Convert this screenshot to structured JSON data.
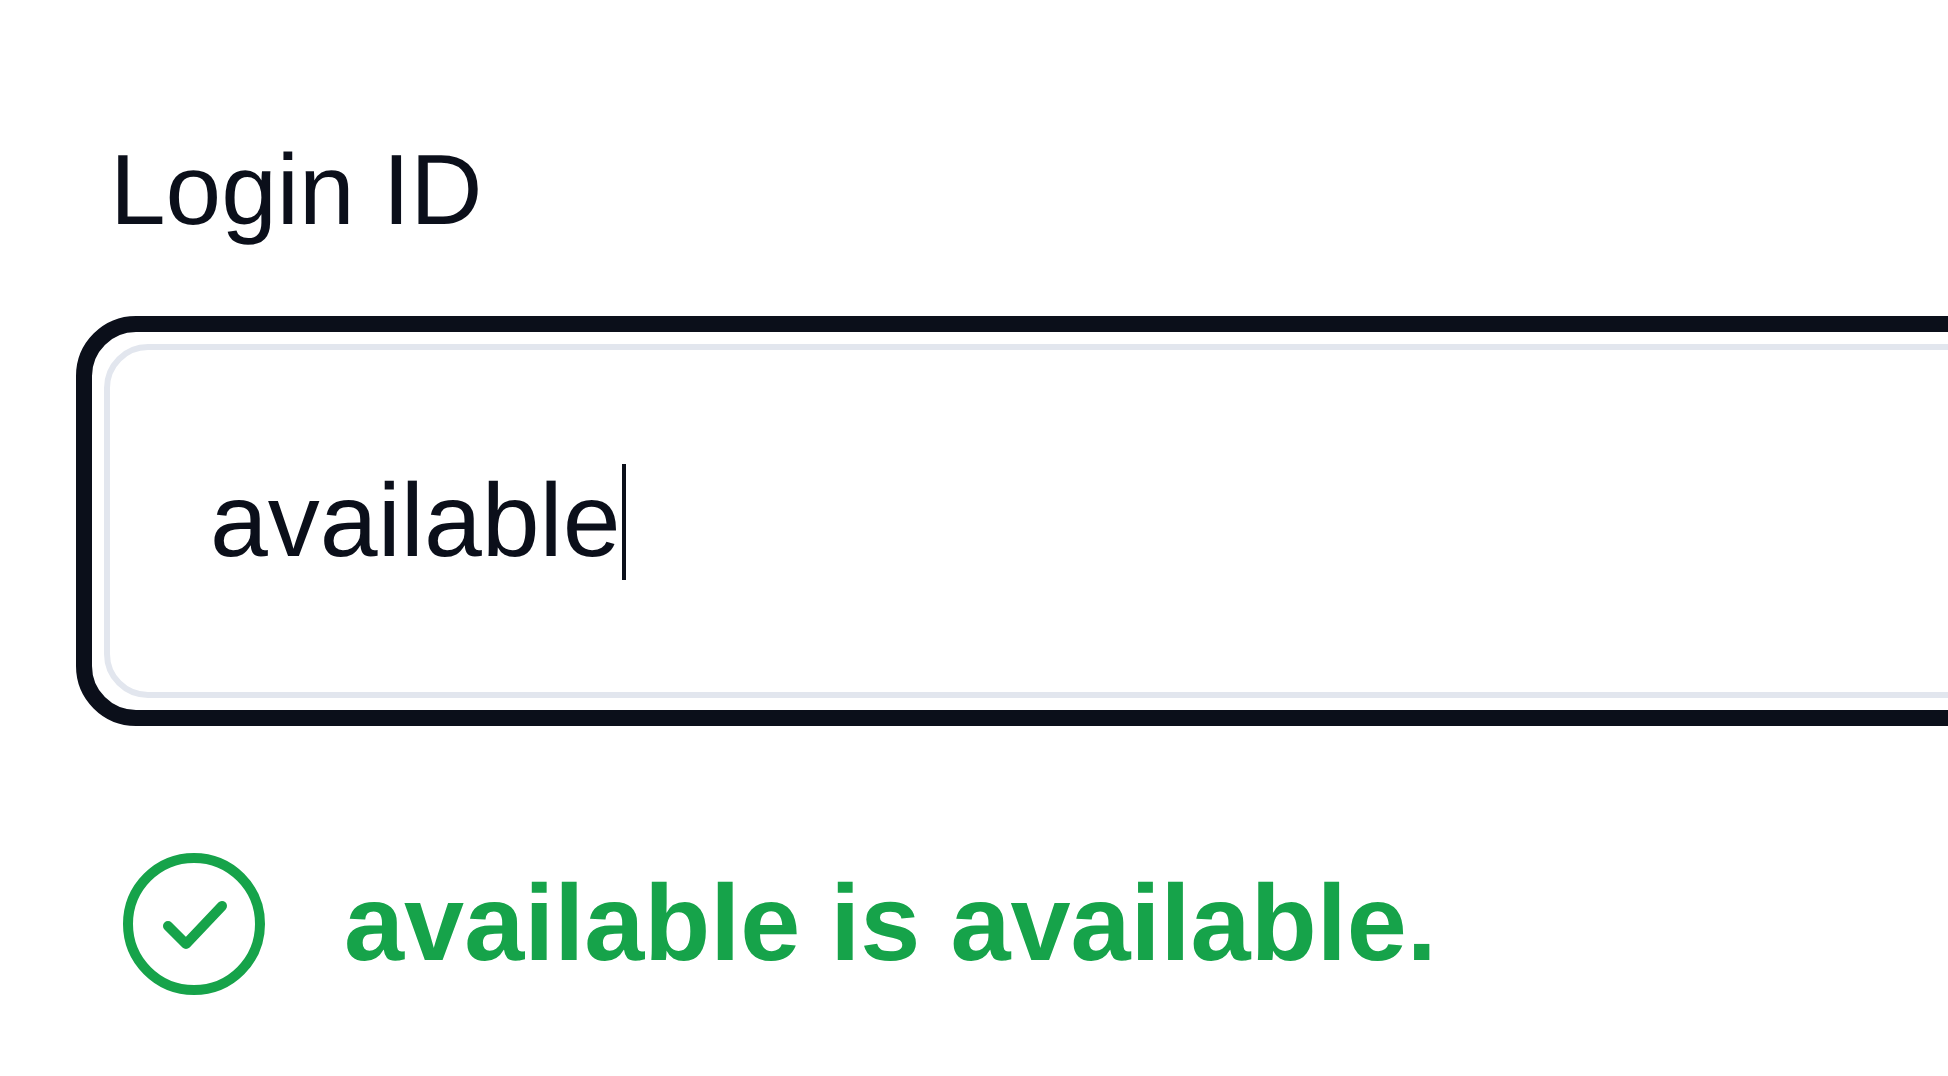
{
  "field": {
    "label": "Login ID",
    "value": "available",
    "focused": true
  },
  "message": {
    "kind": "success",
    "text": "available is available."
  }
}
